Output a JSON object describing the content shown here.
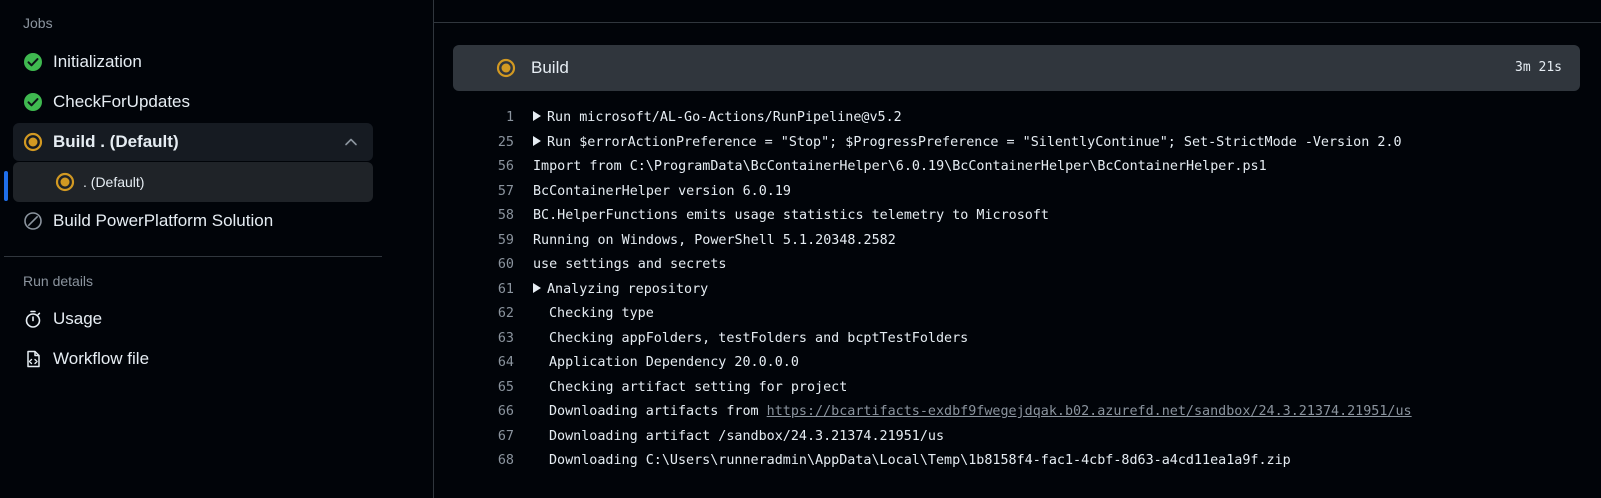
{
  "sidebar": {
    "jobs_label": "Jobs",
    "jobs": [
      {
        "label": "Initialization",
        "status": "success"
      },
      {
        "label": "CheckForUpdates",
        "status": "success"
      },
      {
        "label": "Build . (Default)",
        "status": "in_progress"
      },
      {
        "label": "Build PowerPlatform Solution",
        "status": "skipped"
      }
    ],
    "sub_job": {
      "label": ". (Default)",
      "status": "in_progress"
    },
    "run_details_label": "Run details",
    "run_details": [
      {
        "label": "Usage",
        "icon": "stopwatch-icon"
      },
      {
        "label": "Workflow file",
        "icon": "file-code-icon"
      }
    ]
  },
  "step": {
    "title": "Build",
    "duration": "3m 21s",
    "status": "in_progress"
  },
  "log": {
    "lines": [
      {
        "num": "1",
        "text": "Run microsoft/AL-Go-Actions/RunPipeline@v5.2"
      },
      {
        "num": "25",
        "text": "Run $errorActionPreference = \"Stop\"; $ProgressPreference = \"SilentlyContinue\"; Set-StrictMode -Version 2.0"
      },
      {
        "num": "56",
        "text": "Import from C:\\ProgramData\\BcContainerHelper\\6.0.19\\BcContainerHelper\\BcContainerHelper.ps1"
      },
      {
        "num": "57",
        "text": "BcContainerHelper version 6.0.19"
      },
      {
        "num": "58",
        "text": "BC.HelperFunctions emits usage statistics telemetry to Microsoft"
      },
      {
        "num": "59",
        "text": "Running on Windows, PowerShell 5.1.20348.2582"
      },
      {
        "num": "60",
        "text": "use settings and secrets"
      },
      {
        "num": "61",
        "text": "Analyzing repository"
      },
      {
        "num": "62",
        "text": "Checking type"
      },
      {
        "num": "63",
        "text": "Checking appFolders, testFolders and bcptTestFolders"
      },
      {
        "num": "64",
        "text": "Application Dependency 20.0.0.0"
      },
      {
        "num": "65",
        "text": "Checking artifact setting for project"
      },
      {
        "num": "66",
        "text": "Downloading artifacts from ",
        "link": "https://bcartifacts-exdbf9fwegejdqak.b02.azurefd.net/sandbox/24.3.21374.21951/us"
      },
      {
        "num": "67",
        "text": "Downloading artifact /sandbox/24.3.21374.21951/us"
      },
      {
        "num": "68",
        "text": "Downloading C:\\Users\\runneradmin\\AppData\\Local\\Temp\\1b8158f4-fac1-4cbf-8d63-a4cd11ea1a9f.zip"
      }
    ]
  },
  "colors": {
    "success": "#3fb950",
    "in_progress": "#d29922",
    "muted": "#8b949e",
    "accent": "#1f6feb"
  }
}
